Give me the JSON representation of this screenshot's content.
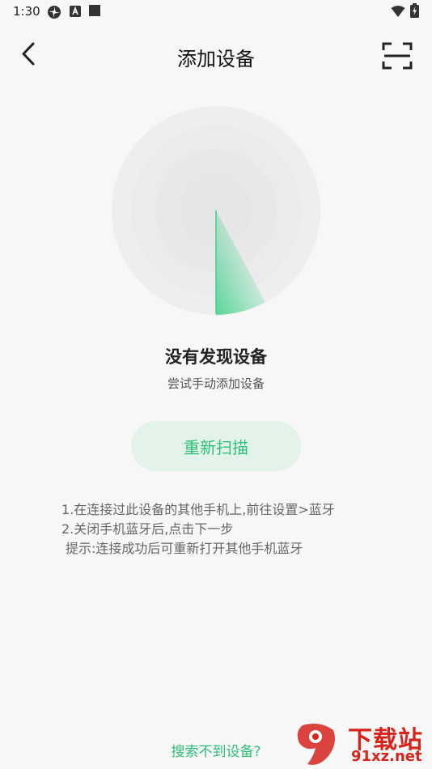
{
  "status_bar": {
    "time": "1:30",
    "left_icons": [
      "pinwheel-icon",
      "a-badge-icon",
      "square-icon"
    ],
    "right_icons": [
      "wifi-icon",
      "battery-charging-icon"
    ]
  },
  "header": {
    "title": "添加设备",
    "back_icon": "chevron-left-icon",
    "scan_icon": "scan-frame-icon"
  },
  "radar": {
    "colors": {
      "outer": "#eeeeee",
      "inner": "#e6e6e6",
      "sweep": "#3fd18a"
    }
  },
  "empty_state": {
    "title": "没有发现设备",
    "subtitle": "尝试手动添加设备"
  },
  "rescan_button": {
    "label": "重新扫描"
  },
  "tips": {
    "line1": "1.在连接过此设备的其他手机上,前往设置>蓝牙",
    "line2": "2.关闭手机蓝牙后,点击下一步",
    "hint": "提示:连接成功后可重新打开其他手机蓝牙"
  },
  "footer_link": {
    "label": "搜索不到设备?"
  },
  "watermark": {
    "text_cn": "下载站",
    "text_url": "91xz.net",
    "brand_color": "#d6241d"
  },
  "colors": {
    "accent": "#2fbf77",
    "accent_bg": "#e3f3ea",
    "background": "#f7f7f7"
  }
}
